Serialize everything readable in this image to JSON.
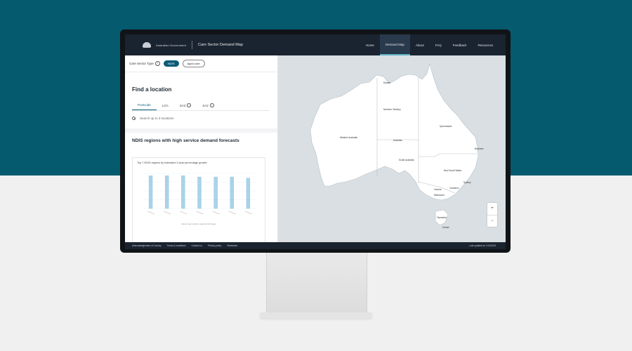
{
  "header": {
    "logo_text": "Australian Government",
    "app_title": "Care Sector Demand Map",
    "nav": [
      "Home",
      "Demand Map",
      "About",
      "FAQ",
      "Feedback",
      "Resources"
    ]
  },
  "care_sector": {
    "label": "Care Sector Type",
    "options": [
      "NDIS",
      "Aged care"
    ],
    "selected": "NDIS"
  },
  "find": {
    "title": "Find a location",
    "tabs": [
      "Postcode",
      "LGA",
      "SA3",
      "SA2"
    ],
    "search_placeholder": "Search up to 3 locations"
  },
  "ndis": {
    "title": "NDIS regions with high service demand forecasts",
    "chart_caption": "Top 7 NDIS regions by estimated 3 year percentage growth",
    "chart_footnote": "Hover over a bar to see the full name",
    "chart_data": {
      "type": "bar",
      "categories": [
        "",
        "",
        "",
        "",
        "",
        "",
        ""
      ],
      "values": [
        28,
        28,
        28,
        27,
        27,
        27,
        26
      ],
      "ylim": [
        0,
        30
      ]
    }
  },
  "map": {
    "states": [
      "Western Australia",
      "Northern Territory",
      "Queensland",
      "South Australia",
      "New South Wales",
      "Victoria",
      "Tasmania"
    ],
    "places": [
      "Darwin",
      "Australia",
      "Brisbane",
      "Sydney",
      "Canberra",
      "Melbourne",
      "Hobart"
    ],
    "zoom_in": "+",
    "zoom_out": "−"
  },
  "footer": {
    "links": [
      "Acknowledgement of Country",
      "Terms & conditions",
      "Contact us",
      "Privacy policy",
      "Disclaimer"
    ],
    "last_updated": "Last updated on 1/11/2023"
  }
}
